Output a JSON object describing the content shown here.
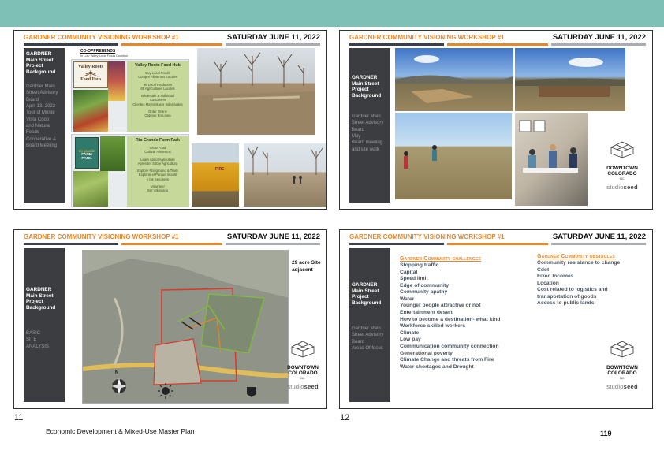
{
  "header": {
    "title": "GARDNER COMMUNITY VISIONING WORKSHOP #1",
    "date": "SATURDAY JUNE 11, 2022"
  },
  "colors": {
    "top_band": "#7ec0b5",
    "accent_orange": "#e8872a",
    "sidebar": "#3b3d40",
    "bar_dark": "#3a3f49",
    "bar_grey": "#a9adb3"
  },
  "slides": [
    {
      "number": "11",
      "sidebar_title": [
        "GARDNER",
        "Main Street",
        "Project",
        "Background"
      ],
      "sidebar_sub": [
        "Gardner Main",
        "Street Advisory",
        "Board",
        "April 13, 2022",
        "Tour of Monte",
        "Vista Coop",
        "and Natural",
        "Foods",
        "Cooperative &",
        "Board Meeting"
      ],
      "coop_heading": "CO-OPPREHENDS",
      "coop_sub": "In Lulu Valley Local Foods Coalition",
      "hub_logo": [
        "Valley Roots",
        "Food Hub"
      ],
      "hub": {
        "title": "Valley Roots Food Hub",
        "lines": [
          "Buy Local Foods",
          "Compre Alimentos Locales",
          "",
          "65 Local Producers",
          "65 Agricultores Locales",
          "",
          "Wholesale & Individual",
          "Customers",
          "Clientes Mayoristas e Individuales",
          "",
          "Order Online",
          "Ordenar En Línea"
        ]
      },
      "farm_logo": [
        "rio grande",
        "FARM PARK"
      ],
      "farm": {
        "title": "Rio Grande Farm Park",
        "lines": [
          "Grow Food",
          "Cultivar Alimentos",
          "",
          "Learn About Agriculture",
          "Aprender Sobre Agricultura",
          "",
          "Explore Playground & Trails",
          "Explorar el Parque Infantil",
          "y los Senderos",
          "",
          "Volunteer",
          "Ser Voluntario"
        ]
      },
      "shed_sign": "FIRE"
    },
    {
      "number": "12",
      "sidebar_title": [
        "GARDNER",
        "Main Street",
        "Project",
        "Background"
      ],
      "sidebar_sub": [
        "Gardner Main",
        "Street Advisory",
        "Board",
        "May",
        "Board meeting",
        "and site walk"
      ]
    },
    {
      "sidebar_title": [
        "GARDNER",
        "Main Street",
        "Project",
        "Background"
      ],
      "sidebar_sub": [
        "BASIC",
        "SITE",
        "ANALYSIS"
      ],
      "map_note": [
        "29 acre Site",
        "adjacent"
      ],
      "map_north": "N"
    },
    {
      "sidebar_title": [
        "GARDNER",
        "Main Street",
        "Project",
        "Background"
      ],
      "sidebar_sub": [
        "Gardner Main",
        "Street Advisory",
        "Board",
        "Areas Of focus"
      ],
      "challenges": {
        "heading": "Gardner Community challenges",
        "items": [
          "Stopping traffic",
          "Capital",
          "Speed limit",
          "Edge of community",
          "Community apathy",
          "Water",
          "Younger people attractive or not",
          "Entertainment desert",
          "How to become a destination- what kind",
          "Workforce skilled workers",
          "Climate",
          "Low pay",
          "Communication community connection",
          "Generational poverty",
          "Climate Change and threats from Fire",
          "Water shortages and Drought"
        ]
      },
      "obstacles": {
        "heading": "Gardner Community obstacles",
        "items": [
          "Community resistance to change",
          "Cdot",
          "Fixed Incomes",
          "Location",
          "Cost related to logistics and",
          "transportation of goods",
          "Access to public lands"
        ]
      }
    }
  ],
  "logo": {
    "name": [
      "DOWNTOWN",
      "COLORADO"
    ],
    "tag": "INC.",
    "studio_light": "studio",
    "studio_bold": "seed"
  },
  "footer": {
    "text": "Economic Development & Mixed-Use Master Plan",
    "page_number": "119"
  }
}
